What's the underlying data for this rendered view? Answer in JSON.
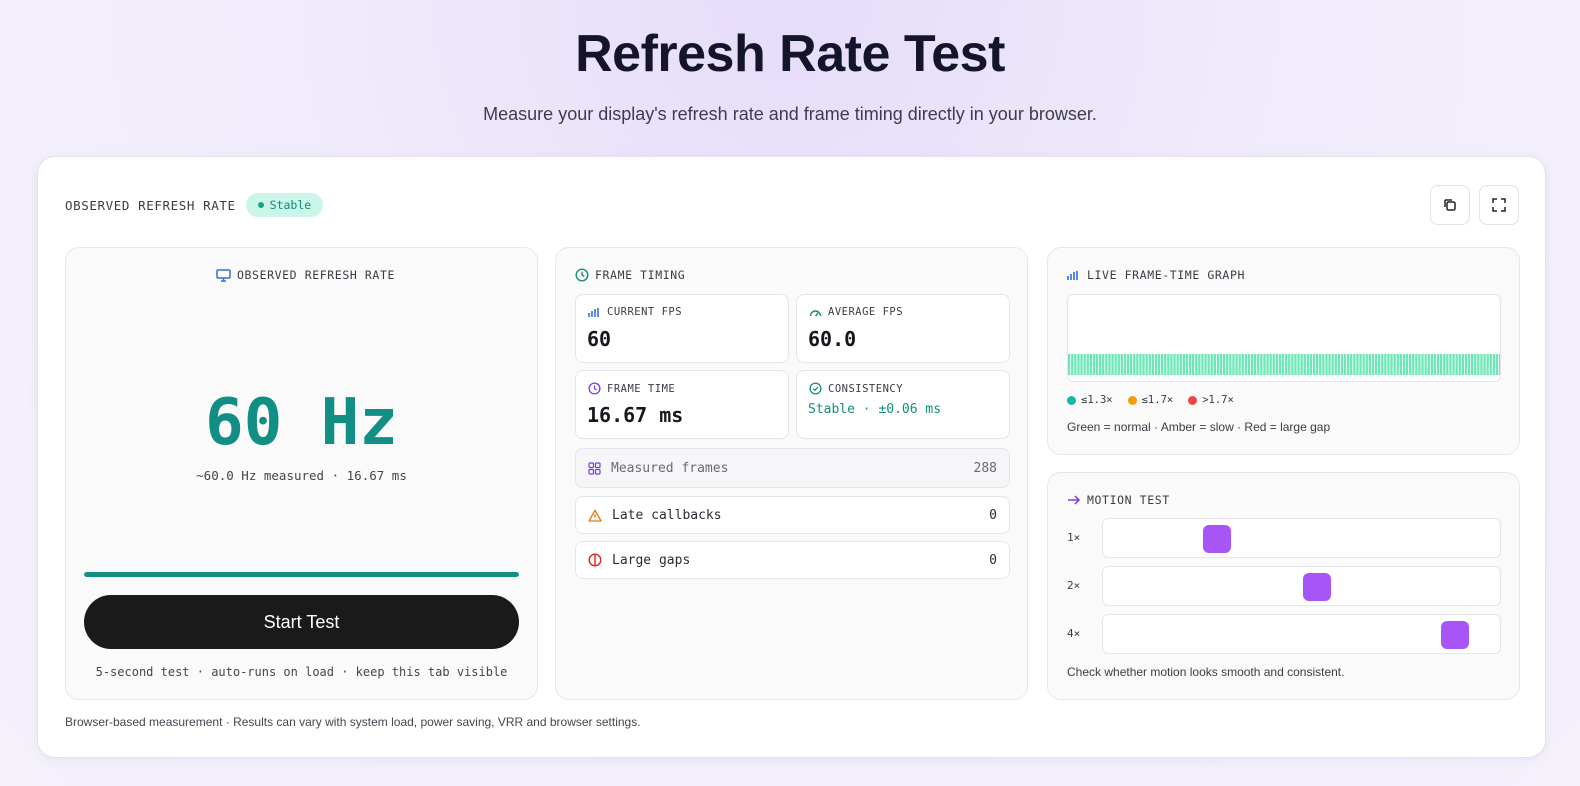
{
  "header": {
    "title": "Refresh Rate Test",
    "subtitle": "Measure your display's refresh rate and frame timing directly in your browser."
  },
  "card": {
    "label": "OBSERVED REFRESH RATE",
    "badge": "Stable",
    "copy_icon": "copy-icon",
    "fullscreen_icon": "fullscreen-icon"
  },
  "refresh_panel": {
    "title": "OBSERVED REFRESH RATE",
    "icon": "monitor-icon",
    "value": "60 Hz",
    "detail": "~60.0 Hz measured · 16.67 ms",
    "progress": 1.0,
    "button": "Start Test",
    "hint": "5-second test · auto-runs on load · keep this tab visible"
  },
  "frame_timing": {
    "title": "FRAME TIMING",
    "current_fps": {
      "label": "CURRENT FPS",
      "value": "60"
    },
    "average_fps": {
      "label": "AVERAGE FPS",
      "value": "60.0"
    },
    "frame_time": {
      "label": "FRAME TIME",
      "value": "16.67 ms"
    },
    "consistency": {
      "label": "CONSISTENCY",
      "value": "Stable · ±0.06 ms"
    },
    "measured_frames": {
      "label": "Measured frames",
      "value": "288"
    },
    "late_callbacks": {
      "label": "Late callbacks",
      "value": "0"
    },
    "large_gaps": {
      "label": "Large gaps",
      "value": "0"
    }
  },
  "graph": {
    "title": "LIVE FRAME-TIME GRAPH",
    "bar_count": 140,
    "bar_level": 0.24,
    "legend": [
      {
        "label": "≤1.3×",
        "color": "#14b8a6"
      },
      {
        "label": "≤1.7×",
        "color": "#f59e0b"
      },
      {
        "label": ">1.7×",
        "color": "#ef4444"
      }
    ],
    "note": "Green = normal · Amber = slow · Red = large gap",
    "bar_color": "#6ee7b7"
  },
  "motion": {
    "title": "MOTION TEST",
    "tracks": [
      {
        "label": "1×",
        "position": 0.27
      },
      {
        "label": "2×",
        "position": 0.54
      },
      {
        "label": "4×",
        "position": 0.91
      }
    ],
    "note": "Check whether motion looks smooth and consistent."
  },
  "footer": "Browser-based measurement · Results can vary with system load, power saving, VRR and browser settings."
}
